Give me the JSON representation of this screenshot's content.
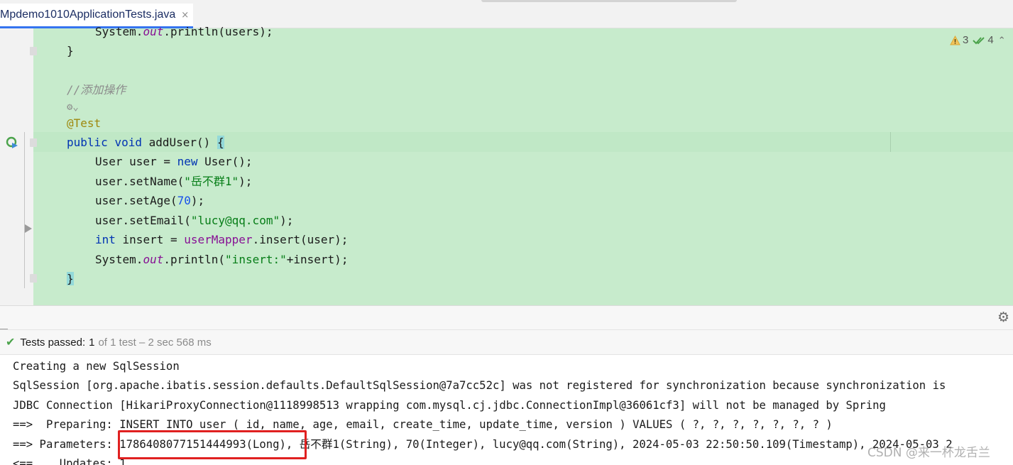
{
  "tab": {
    "label": "Mpdemo1010ApplicationTests.java",
    "close_glyph": "×"
  },
  "inspections": {
    "warnings": "3",
    "typos": "4"
  },
  "code": {
    "line1_prefix": "System.",
    "line1_field": "out",
    "line1_suffix": ".println(users);",
    "line2": "}",
    "comment": "//添加操作",
    "annotation": "@Test",
    "sig_public": "public",
    "sig_void": "void",
    "sig_name": " addUser() ",
    "sig_brace": "{",
    "l_user_type": "User user = ",
    "l_user_new": "new",
    "l_user_ctor": " User();",
    "l_name_pre": "user.setName(",
    "l_name_str": "\"岳不群1\"",
    "l_name_post": ");",
    "l_age_pre": "user.setAge(",
    "l_age_num": "70",
    "l_age_post": ");",
    "l_email_pre": "user.setEmail(",
    "l_email_str": "\"lucy@qq.com\"",
    "l_email_post": ");",
    "l_insert_int": "int",
    "l_insert_mid": " insert = ",
    "l_insert_mapper": "userMapper",
    "l_insert_post": ".insert(user);",
    "l_print_pre": "System.",
    "l_print_field": "out",
    "l_print_mid": ".println(",
    "l_print_str": "\"insert:\"",
    "l_print_post": "+insert);",
    "close_brace": "}"
  },
  "test_status": {
    "label": "Tests passed:",
    "count": "1",
    "rest": "of 1 test – 2 sec 568 ms"
  },
  "console": {
    "lines": [
      "Creating a new SqlSession",
      "SqlSession [org.apache.ibatis.session.defaults.DefaultSqlSession@7a7cc52c] was not registered for synchronization because synchronization is",
      "JDBC Connection [HikariProxyConnection@1118998513 wrapping com.mysql.cj.jdbc.ConnectionImpl@36061cf3] will not be managed by Spring",
      "==>  Preparing: INSERT INTO user ( id, name, age, email, create_time, update_time, version ) VALUES ( ?, ?, ?, ?, ?, ?, ? )",
      "==> Parameters: 1786408077151444993(Long), 岳不群1(String), 70(Integer), lucy@qq.com(String), 2024-05-03 22:50:50.109(Timestamp), 2024-05-03 2",
      "<==    Updates: 1"
    ]
  },
  "watermark": "CSDN @来一杯龙舌兰",
  "colors": {
    "editor_bg": "#c7ebcc",
    "keyword": "#0033b3",
    "string": "#067d17",
    "annotation": "#9e880d",
    "highlight_box": "#e02020"
  }
}
